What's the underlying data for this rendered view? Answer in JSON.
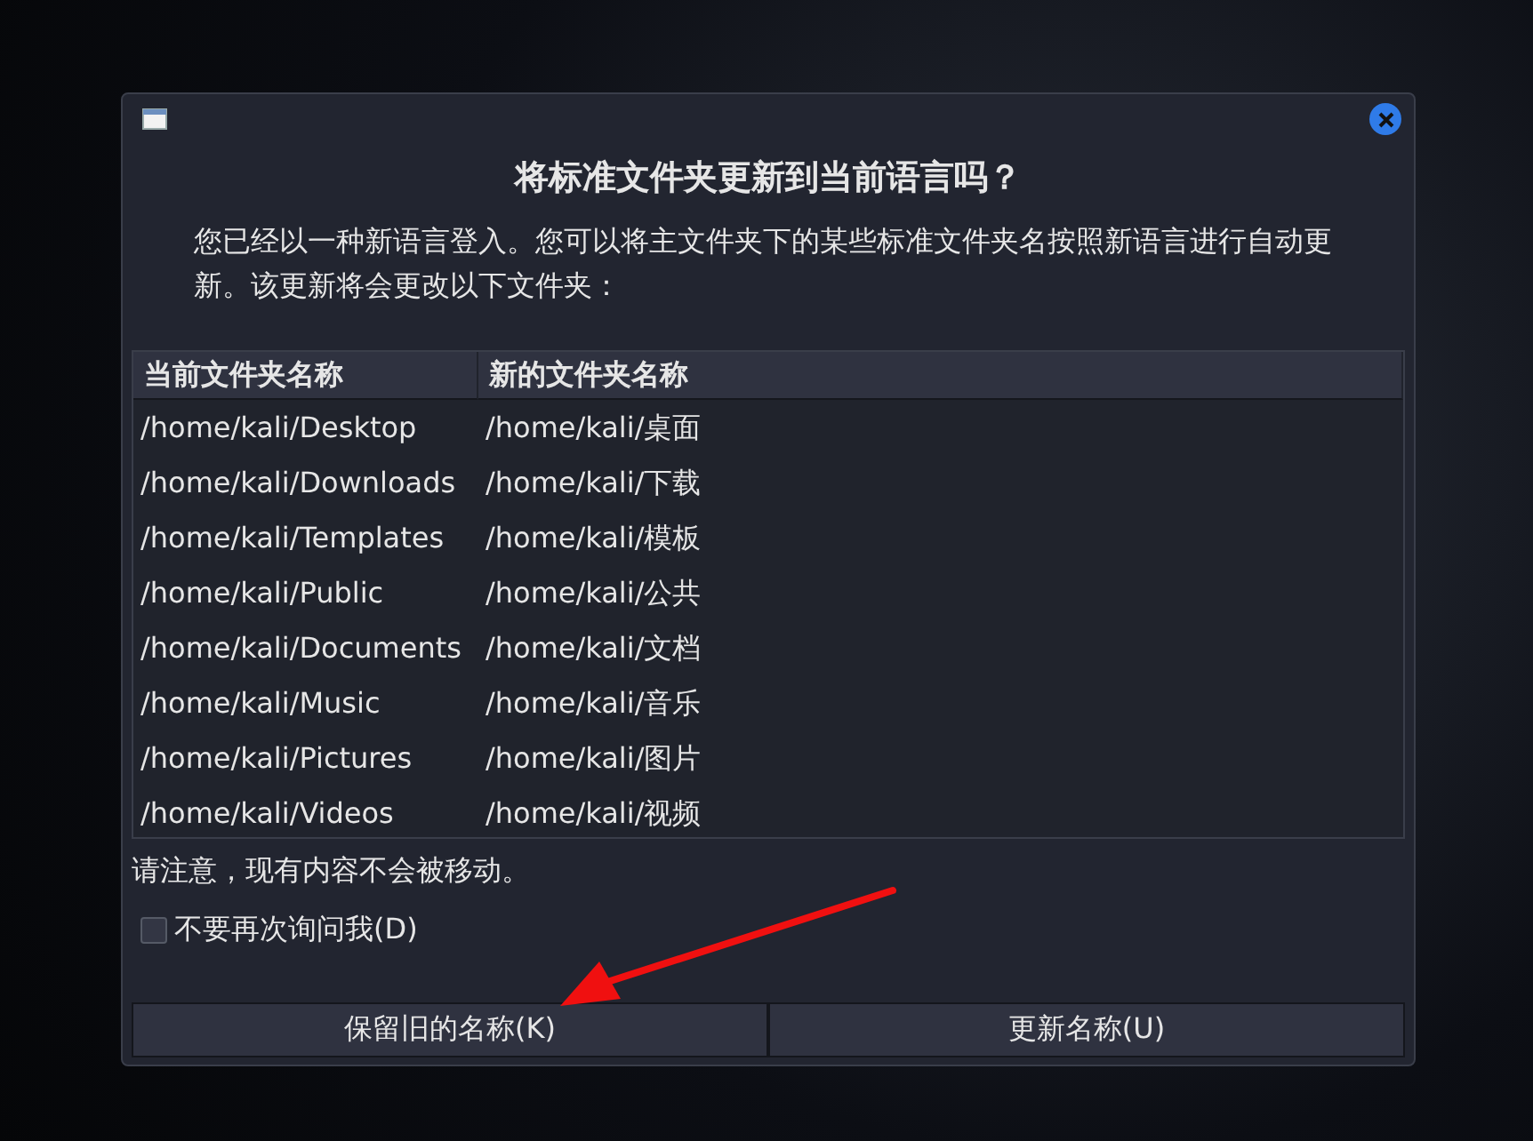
{
  "dialog": {
    "heading": "将标准文件夹更新到当前语言吗？",
    "message": "您已经以一种新语言登入。您可以将主文件夹下的某些标准文件夹名按照新语言进行自动更新。该更新将会更改以下文件夹：",
    "table": {
      "columns": [
        "当前文件夹名称",
        "新的文件夹名称"
      ],
      "rows": [
        [
          "/home/kali/Desktop",
          "/home/kali/桌面"
        ],
        [
          "/home/kali/Downloads",
          "/home/kali/下载"
        ],
        [
          "/home/kali/Templates",
          "/home/kali/模板"
        ],
        [
          "/home/kali/Public",
          "/home/kali/公共"
        ],
        [
          "/home/kali/Documents",
          "/home/kali/文档"
        ],
        [
          "/home/kali/Music",
          "/home/kali/音乐"
        ],
        [
          "/home/kali/Pictures",
          "/home/kali/图片"
        ],
        [
          "/home/kali/Videos",
          "/home/kali/视频"
        ]
      ]
    },
    "note": "请注意，现有内容不会被移动。",
    "checkbox": {
      "label": "不要再次询问我(D)",
      "checked": false
    },
    "buttons": [
      "保留旧的名称(K)",
      "更新名称(U)"
    ]
  }
}
